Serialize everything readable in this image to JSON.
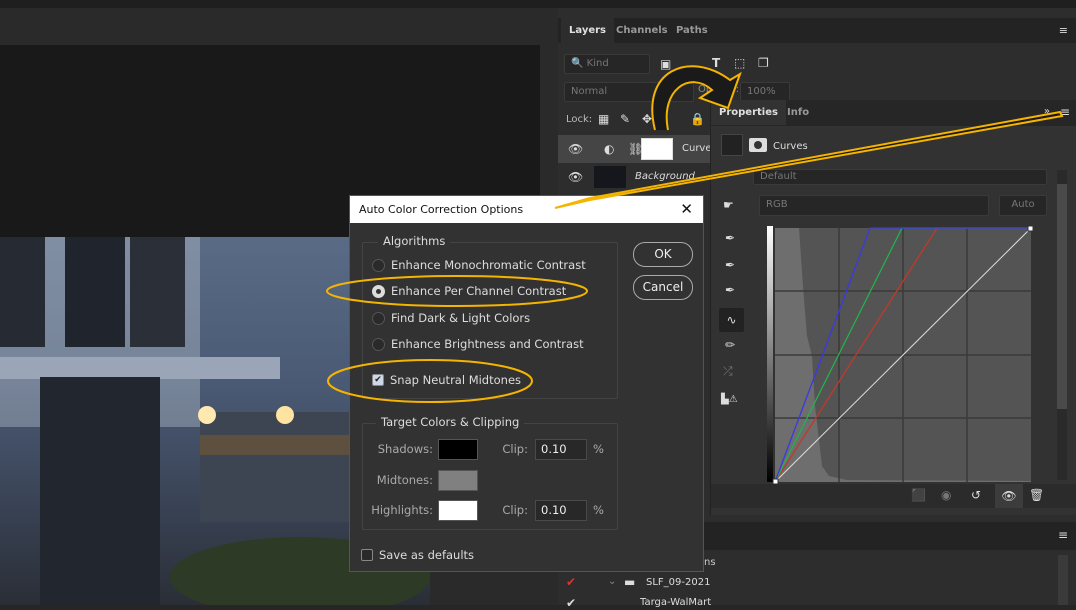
{
  "layers_panel": {
    "tabs": [
      {
        "label": "Layers",
        "active": true
      },
      {
        "label": "Channels"
      },
      {
        "label": "Paths"
      }
    ],
    "filter_kind": "Kind",
    "blend_mode": "Normal",
    "opacity_label": "Opacity:",
    "opacity_value": "100%",
    "lock_label": "Lock:",
    "layers": [
      {
        "name": "Curves",
        "visible": true
      },
      {
        "name": "Background",
        "visible": true
      }
    ]
  },
  "properties_panel": {
    "tabs": [
      {
        "label": "Properties",
        "active": true
      },
      {
        "label": "Info"
      }
    ],
    "adjustment_title": "Curves",
    "preset_value": "Default",
    "channel_value": "RGB",
    "auto_label": "Auto",
    "curves": {
      "colors": {
        "red": "#c0392b",
        "green": "#22b14c",
        "blue": "#3a3ae0"
      }
    }
  },
  "dialog": {
    "title": "Auto Color Correction Options",
    "algorithms_label": "Algorithms",
    "options": [
      {
        "label": "Enhance Monochromatic Contrast",
        "selected": false
      },
      {
        "label": "Enhance Per Channel Contrast",
        "selected": true
      },
      {
        "label": "Find Dark & Light Colors",
        "selected": false
      },
      {
        "label": "Enhance Brightness and Contrast",
        "selected": false
      }
    ],
    "snap_label": "Snap Neutral Midtones",
    "snap_checked": true,
    "target_label": "Target Colors & Clipping",
    "shadows_label": "Shadows:",
    "midtones_label": "Midtones:",
    "highlights_label": "Highlights:",
    "clip_label": "Clip:",
    "shadows_clip": "0.10",
    "highlights_clip": "0.10",
    "percent": "%",
    "shadows_color": "#000000",
    "midtones_color": "#808080",
    "highlights_color": "#ffffff",
    "save_defaults_label": "Save as defaults",
    "save_defaults_checked": false,
    "ok_label": "OK",
    "cancel_label": "Cancel"
  },
  "bottom_panel": {
    "partial_label": "ns",
    "items": [
      {
        "name": "SLF_09-2021",
        "checked": true
      },
      {
        "name": "Targa-WalMart",
        "checked": true
      }
    ]
  },
  "annotation_color": "#f5b400"
}
